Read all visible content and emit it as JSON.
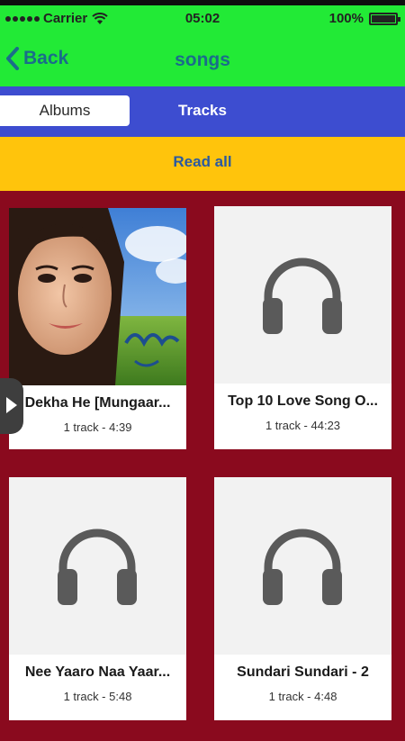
{
  "status_bar": {
    "carrier": "Carrier",
    "time": "05:02",
    "battery": "100%"
  },
  "nav": {
    "back_label": "Back",
    "title": "songs"
  },
  "tabs": [
    {
      "label": "Albums",
      "selected": true
    },
    {
      "label": "Tracks",
      "selected": false
    }
  ],
  "read_all": "Read all",
  "albums": [
    {
      "title": "Dekha He [Mungaar...",
      "meta": "1 track - 4:39",
      "art": "photo"
    },
    {
      "title": "Top 10 Love Song O...",
      "meta": "1 track - 44:23",
      "art": "headphones-icon"
    },
    {
      "title": "Nee Yaaro Naa Yaar...",
      "meta": "1 track - 5:48",
      "art": "headphones-icon"
    },
    {
      "title": "Sundari Sundari - 2",
      "meta": "1 track - 4:48",
      "art": "headphones-icon"
    }
  ],
  "colors": {
    "status_nav_bg": "#22ea36",
    "tab_bar_bg": "#3d4dd0",
    "read_all_bg": "#ffc40c",
    "grid_bg": "#8a0a1e",
    "link_text": "#1a6d8a"
  }
}
